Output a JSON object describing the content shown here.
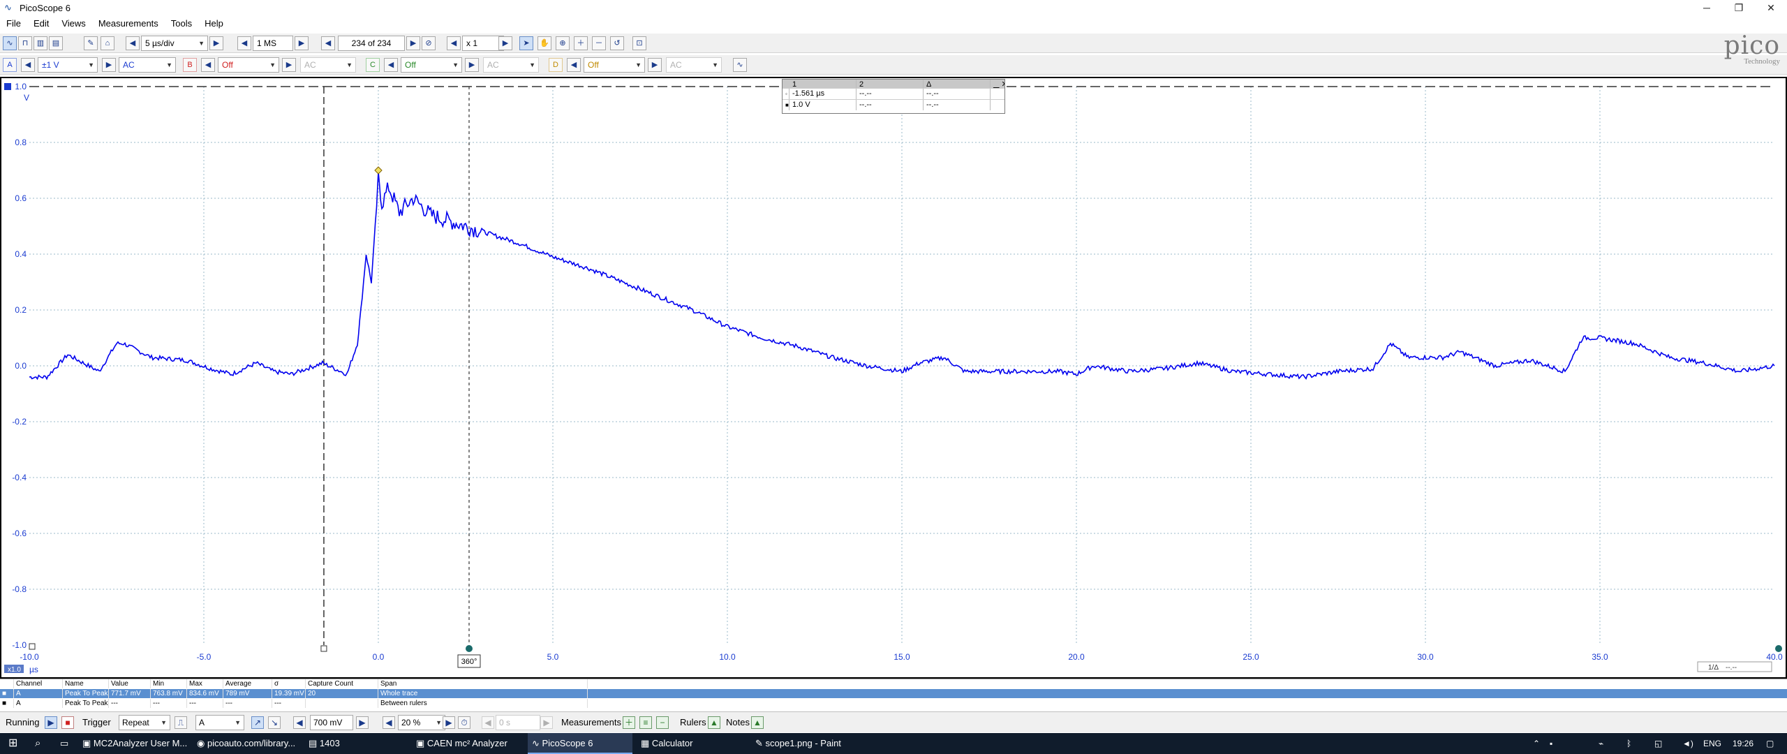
{
  "window": {
    "title": "PicoScope 6",
    "minimize_icon": "minimize-icon",
    "maximize_icon": "restore-icon",
    "close_icon": "close-icon"
  },
  "menu": [
    "File",
    "Edit",
    "Views",
    "Measurements",
    "Tools",
    "Help"
  ],
  "toolbar": {
    "timebase": "5 µs/div",
    "samples": "1 MS",
    "buffer": "234 of 234",
    "zoom": "x 1"
  },
  "channels": {
    "a": {
      "label": "A",
      "range": "±1 V",
      "coupling": "AC"
    },
    "b": {
      "label": "B",
      "range": "Off",
      "coupling": "AC"
    },
    "c": {
      "label": "C",
      "range": "Off",
      "coupling": "AC"
    },
    "d": {
      "label": "D",
      "range": "Off",
      "coupling": "AC"
    }
  },
  "logo": {
    "word": "pico",
    "sub": "Technology"
  },
  "scope": {
    "y_unit": "V",
    "x_unit": "µs",
    "y_ticks": [
      "1.0",
      "0.8",
      "0.6",
      "0.4",
      "0.2",
      "0.0",
      "-0.2",
      "-0.4",
      "-0.6",
      "-0.8",
      "-1.0"
    ],
    "x_ticks": [
      "-10.0",
      "-5.0",
      "0.0",
      "5.0",
      "10.0",
      "15.0",
      "20.0",
      "25.0",
      "30.0",
      "35.0",
      "40.0"
    ],
    "phase_label": "360°",
    "scale_badge": "x1.0",
    "corner_readout": "--.--",
    "corner_label": "1/Δ"
  },
  "ruler_table": {
    "headers": [
      "1",
      "2",
      "Δ"
    ],
    "rows": [
      [
        "-1.561 µs",
        "--.--",
        "--.--"
      ],
      [
        "1.0 V",
        "--.--",
        "--.--"
      ]
    ]
  },
  "measurements": {
    "headers": [
      "Channel",
      "Name",
      "Value",
      "Min",
      "Max",
      "Average",
      "σ",
      "Capture Count",
      "Span"
    ],
    "rows": [
      [
        "A",
        "Peak To Peak",
        "771.7 mV",
        "763.8 mV",
        "834.6 mV",
        "789 mV",
        "19.39 mV",
        "20",
        "Whole trace"
      ],
      [
        "A",
        "Peak To Peak",
        "---",
        "---",
        "---",
        "---",
        "---",
        "",
        "Between rulers"
      ]
    ]
  },
  "status": {
    "running": "Running",
    "trigger_label": "Trigger",
    "trigger_mode": "Repeat",
    "trigger_source": "A",
    "threshold": "700 mV",
    "pre_trigger": "20 %",
    "delay": "0 s",
    "measurements_label": "Measurements",
    "rulers_label": "Rulers",
    "notes_label": "Notes"
  },
  "taskbar": {
    "tasks": [
      "MC2Analyzer User M...",
      "picoauto.com/library...",
      "1403",
      "CAEN mc² Analyzer",
      "PicoScope 6",
      "Calculator",
      "scope1.png - Paint"
    ],
    "lang": "ENG",
    "time": "19:26"
  },
  "chart_data": {
    "type": "line",
    "x_unit": "µs",
    "y_unit": "V",
    "xlim": [
      -10,
      40
    ],
    "ylim": [
      -1,
      1
    ],
    "grid": true,
    "series": [
      {
        "color": "#0000ee",
        "x": [
          -10,
          -9.5,
          -8.9,
          -8.0,
          -7.5,
          -7.3,
          -6.5,
          -5.5,
          -4.8,
          -4.2,
          -3.5,
          -3.0,
          -2.5,
          -1.6,
          -0.9,
          -0.6,
          -0.5,
          -0.35,
          -0.2,
          -0.05,
          0.0,
          0.1,
          0.3,
          0.6,
          1.0,
          1.5,
          2.0,
          2.5,
          3.0,
          4.0,
          5.0,
          6.0,
          7.0,
          8.0,
          9.0,
          10.0,
          11.0,
          12.0,
          13.0,
          14.0,
          15.0,
          15.5,
          16.2,
          16.8,
          17.5,
          18.5,
          19.5,
          20.0,
          20.5,
          21.5,
          22.5,
          23.5,
          24.5,
          25.5,
          26.5,
          27.5,
          28.5,
          29.0,
          29.5,
          30.5,
          31.0,
          32.0,
          33.0,
          34.0,
          34.5,
          35.0,
          35.5,
          36.0,
          37.0,
          38.0,
          39.0,
          40.0
        ],
        "y": [
          -0.04,
          -0.04,
          0.04,
          -0.02,
          0.08,
          0.08,
          0.03,
          0.02,
          -0.01,
          -0.03,
          0.01,
          -0.02,
          -0.03,
          0.01,
          -0.03,
          0.08,
          0.2,
          0.4,
          0.3,
          0.57,
          0.69,
          0.58,
          0.64,
          0.55,
          0.6,
          0.54,
          0.52,
          0.5,
          0.48,
          0.44,
          0.39,
          0.35,
          0.3,
          0.25,
          0.2,
          0.14,
          0.1,
          0.07,
          0.03,
          0.0,
          -0.02,
          0.01,
          0.03,
          -0.02,
          -0.02,
          -0.02,
          -0.02,
          -0.03,
          0.0,
          -0.02,
          -0.01,
          0.01,
          -0.02,
          -0.03,
          -0.04,
          -0.02,
          -0.01,
          0.08,
          0.03,
          0.03,
          0.05,
          0.0,
          0.02,
          -0.02,
          0.1,
          0.1,
          0.09,
          0.08,
          0.03,
          0.01,
          -0.02,
          0.0
        ]
      }
    ],
    "rulers_x": [
      -1.561,
      2.6
    ],
    "ruler_y": 1.0,
    "marker_point": {
      "x": 0.0,
      "y": 0.7
    }
  }
}
